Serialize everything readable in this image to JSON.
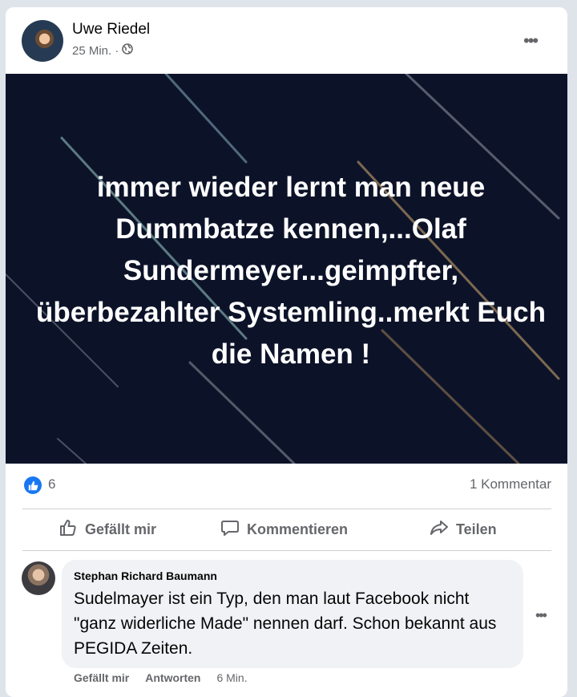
{
  "post": {
    "author": "Uwe Riedel",
    "time": "25 Min. ·",
    "audience_icon": "globe-icon",
    "image_text": "immer wieder lernt man neue Dummbatze kennen,...Olaf Sundermeyer...geimpfter, überbezahlter Systemling..merkt Euch die Namen !",
    "reaction_icon": "like-icon",
    "reaction_count": "6",
    "comment_count": "1 Kommentar"
  },
  "actions": {
    "like": "Gefällt mir",
    "comment": "Kommentieren",
    "share": "Teilen"
  },
  "comment": {
    "author": "Stephan Richard Baumann",
    "text": "Sudelmayer ist ein Typ, den man laut Facebook nicht \"ganz widerliche Made\" nennen darf. Schon bekannt aus PEGIDA Zeiten.",
    "like": "Gefällt mir",
    "reply": "Antworten",
    "time": "6 Min."
  },
  "colors": {
    "accent": "#1877f2",
    "image_bg": "#0c1329",
    "secondary_text": "#65676b"
  }
}
